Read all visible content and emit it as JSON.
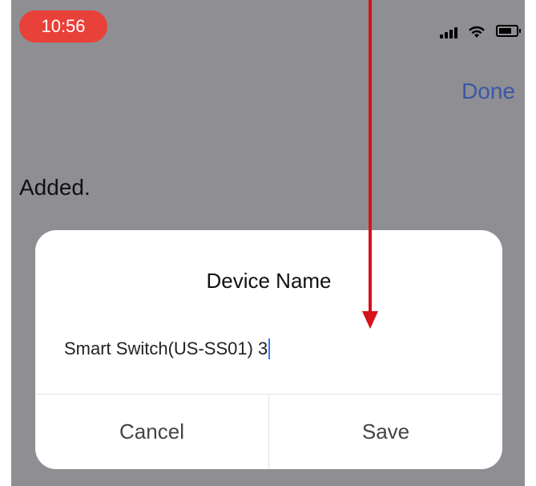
{
  "status_bar": {
    "time": "10:56",
    "icons": [
      "signal-icon",
      "wifi-icon",
      "battery-icon"
    ]
  },
  "header": {
    "done_label": "Done"
  },
  "page": {
    "status_text": "Added."
  },
  "dialog": {
    "title": "Device Name",
    "input_value": "Smart Switch(US-SS01) 3",
    "cancel_label": "Cancel",
    "save_label": "Save"
  },
  "colors": {
    "overlay": "#8e8e93",
    "time_pill": "#e8413a",
    "done": "#3b57a8",
    "annotation_arrow": "#d6111b",
    "cursor": "#3478f6"
  }
}
